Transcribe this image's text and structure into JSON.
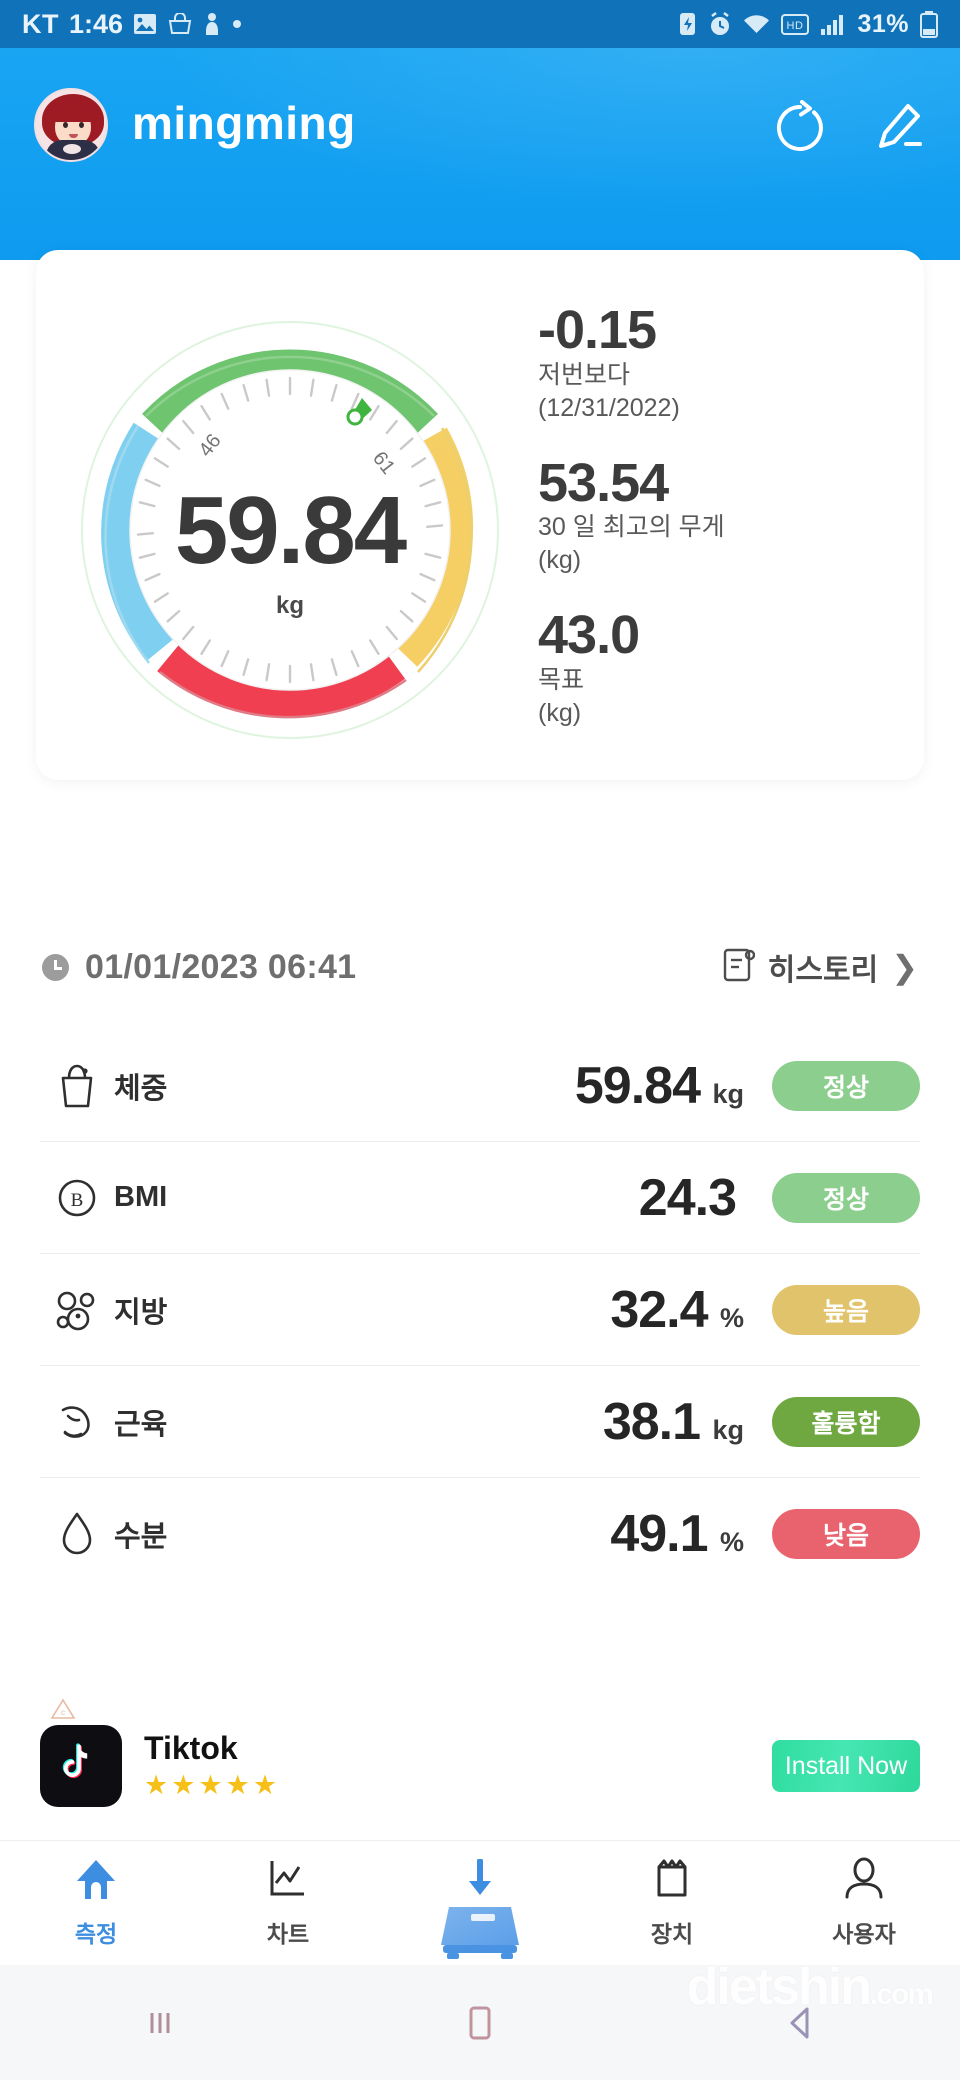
{
  "statusbar": {
    "carrier": "KT",
    "time": "1:46",
    "battery": "31%",
    "left_icons": [
      "photo-icon",
      "shopping-bag-icon",
      "person-icon",
      "dot-icon"
    ],
    "right_icons": [
      "battery-saver-icon",
      "alarm-icon",
      "wifi-icon",
      "hd-icon",
      "signal-icon"
    ]
  },
  "header": {
    "username": "mingming",
    "avatar": "user-avatar",
    "sync_icon": "refresh-icon",
    "edit_icon": "pencil-icon"
  },
  "gauge": {
    "value": "59.84",
    "unit": "kg",
    "tick_low": "46",
    "tick_high": "61"
  },
  "stats": [
    {
      "value": "-0.15",
      "label_line1": "저번보다",
      "label_line2": "(12/31/2022)"
    },
    {
      "value": "53.54",
      "label_line1": "30 일 최고의 무게",
      "label_line2": "(kg)"
    },
    {
      "value": "43.0",
      "label_line1": "목표",
      "label_line2": "(kg)"
    }
  ],
  "timestamp": {
    "icon": "clock-icon",
    "text": "01/01/2023 06:41",
    "history_label": "히스토리",
    "chevron": "❯"
  },
  "metrics": [
    {
      "icon": "weight-scale-icon",
      "name": "체중",
      "value": "59.84",
      "unit": "kg",
      "badge": "정상",
      "badge_color": "#8cce8e"
    },
    {
      "icon": "bmi-icon",
      "name": "BMI",
      "value": "24.3",
      "unit": "",
      "badge": "정상",
      "badge_color": "#8cce8e"
    },
    {
      "icon": "fat-cells-icon",
      "name": "지방",
      "value": "32.4",
      "unit": "%",
      "badge": "높음",
      "badge_color": "#e2c濃"
    },
    {
      "icon": "muscle-arm-icon",
      "name": "근육",
      "value": "38.1",
      "unit": "kg",
      "badge": "훌륭함",
      "badge_color": "#6fa840"
    },
    {
      "icon": "water-drop-icon",
      "name": "수분",
      "value": "49.1",
      "unit": "%",
      "badge": "낮음",
      "badge_color": "#e9636f"
    }
  ],
  "metric_badge_colors": [
    "#8cce8e",
    "#8cce8e",
    "#e0c36b",
    "#6fa840",
    "#e9636f"
  ],
  "ad": {
    "icon": "tiktok-icon",
    "title": "Tiktok",
    "stars": "★★★★★",
    "cta": "Install Now",
    "ad_mark": "ad-choices-icon"
  },
  "bottom_nav": [
    {
      "icon": "home-icon",
      "label": "측정",
      "active": true
    },
    {
      "icon": "chart-line-icon",
      "label": "차트",
      "active": false
    },
    {
      "icon": "scale-device-icon",
      "label": "",
      "active": false
    },
    {
      "icon": "device-clipboard-icon",
      "label": "장치",
      "active": false
    },
    {
      "icon": "user-person-icon",
      "label": "사용자",
      "active": false
    }
  ],
  "android_nav": {
    "recents": "recents-icon",
    "home": "home-square-icon",
    "back": "back-triangle-icon"
  },
  "watermark": {
    "text": "dietshin",
    "suffix": ".com"
  },
  "colors": {
    "header_blue": "#19a5f2",
    "status_blue": "#1072b8",
    "accent": "#3d8ee0",
    "green": "#6ec46f",
    "yellow": "#f5cf63",
    "red": "#ef3f51",
    "cyan": "#7fd0f0"
  }
}
